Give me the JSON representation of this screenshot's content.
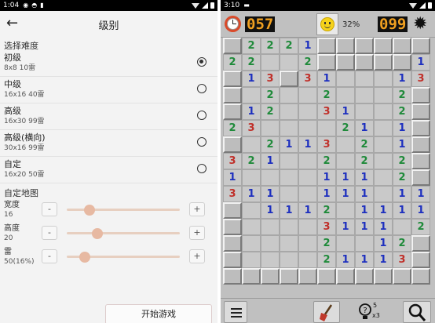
{
  "left": {
    "status": {
      "time": "1:04",
      "icons": [
        "cast-icon",
        "wifi-small-icon",
        "sd-card-icon"
      ]
    },
    "title": "级别",
    "difficulty_header": "选择难度",
    "options": [
      {
        "name": "初级",
        "detail": "8x8 10雷",
        "selected": true
      },
      {
        "name": "中级",
        "detail": "16x16 40雷",
        "selected": false
      },
      {
        "name": "高级",
        "detail": "16x30 99雷",
        "selected": false
      },
      {
        "name": "高级(横向)",
        "detail": "30x16 99雷",
        "selected": false
      },
      {
        "name": "自定",
        "detail": "16x20 50雷",
        "selected": false
      }
    ],
    "custom_header": "自定地图",
    "sliders": [
      {
        "label": "宽度",
        "value": "16",
        "level": 0.2
      },
      {
        "label": "高度",
        "value": "20",
        "level": 0.27
      },
      {
        "label": "雷",
        "value": "50(16%)",
        "level": 0.16
      }
    ],
    "minus_label": "-",
    "plus_label": "+",
    "start_label": "开始游戏"
  },
  "right": {
    "status": {
      "time": "3:10"
    },
    "counter_left": "057",
    "happiness": "32%",
    "counter_right": "099",
    "colors": {
      "one": "#1d2fbf",
      "two": "#1f8a3a",
      "three": "#c0302a",
      "lcd": "#f0a020"
    },
    "board": [
      [
        "c",
        "2",
        "2",
        "2",
        "1",
        "c",
        "c",
        "c",
        "c",
        "c",
        "c"
      ],
      [
        "2",
        "2",
        "",
        "",
        "2",
        "c",
        "c",
        "c",
        "c",
        "c",
        "1"
      ],
      [
        "c",
        "1",
        "3",
        "c",
        "3",
        "1",
        "",
        "",
        "",
        "1",
        "3"
      ],
      [
        "c",
        "",
        "2",
        "",
        "",
        "2",
        "",
        "",
        "",
        "2",
        "c"
      ],
      [
        "c",
        "1",
        "2",
        "",
        "",
        "3",
        "1",
        "",
        "",
        "2",
        "c"
      ],
      [
        "2",
        "3",
        "",
        "",
        "",
        "",
        "2",
        "1",
        "",
        "1",
        "c"
      ],
      [
        "c",
        "",
        "2",
        "1",
        "1",
        "3",
        "",
        "2",
        "",
        "1",
        "c"
      ],
      [
        "3",
        "2",
        "1",
        "",
        "",
        "2",
        "",
        "2",
        "",
        "2",
        "c"
      ],
      [
        "1",
        "",
        "",
        "",
        "",
        "1",
        "1",
        "1",
        "",
        "2",
        "c"
      ],
      [
        "3",
        "1",
        "1",
        "",
        "",
        "1",
        "1",
        "1",
        "",
        "1",
        "1"
      ],
      [
        "c",
        "",
        "1",
        "1",
        "1",
        "2",
        "",
        "1",
        "1",
        "1",
        "1"
      ],
      [
        "c",
        "",
        "",
        "",
        "",
        "3",
        "1",
        "1",
        "1",
        "",
        "2"
      ],
      [
        "c",
        "",
        "",
        "",
        "",
        "2",
        "",
        "",
        "1",
        "2",
        "c"
      ],
      [
        "c",
        "",
        "",
        "",
        "",
        "2",
        "1",
        "1",
        "1",
        "3",
        "c"
      ],
      [
        "c",
        "c",
        "c",
        "c",
        "c",
        "c",
        "c",
        "c",
        "c",
        "c",
        "c"
      ]
    ],
    "hint": {
      "count": "5",
      "multiplier": "x3"
    }
  }
}
